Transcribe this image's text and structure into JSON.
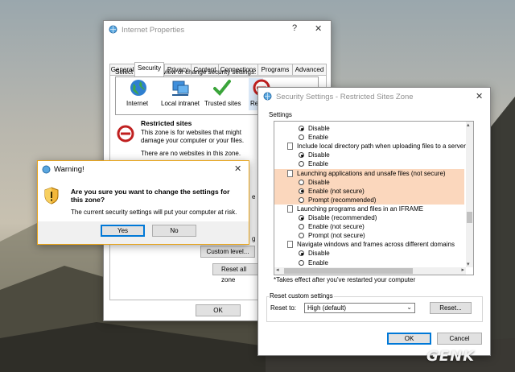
{
  "internet_properties": {
    "title": "Internet Properties",
    "help": "?",
    "close": "✕",
    "tabs": [
      "General",
      "Security",
      "Privacy",
      "Content",
      "Connections",
      "Programs",
      "Advanced"
    ],
    "select_zone_text": "Select a zone to view or change security settings.",
    "zones": [
      {
        "label": "Internet",
        "icon": "globe-icon"
      },
      {
        "label": "Local intranet",
        "icon": "intranet-icon"
      },
      {
        "label": "Trusted sites",
        "icon": "checkmark-icon"
      },
      {
        "label": "Re",
        "icon": "restricted-icon"
      }
    ],
    "zone_heading": "Restricted sites",
    "zone_desc_line1": "This zone is for websites that might",
    "zone_desc_line2": "damage your computer or your files.",
    "zone_desc_line3": "There are no websites in this zone.",
    "custom_level": "Custom level...",
    "reset_all": "Reset all zone",
    "ok": "OK",
    "behind_text_1": "e",
    "behind_text_2": "g"
  },
  "warning": {
    "title": "Warning!",
    "close": "✕",
    "question_line1": "Are you sure you want to change the settings for",
    "question_line2": "this zone?",
    "detail": "The current security settings will put your computer at risk.",
    "yes": "Yes",
    "no": "No"
  },
  "security_settings": {
    "title": "Security Settings - Restricted Sites Zone",
    "close": "✕",
    "settings_label": "Settings",
    "rows": [
      {
        "kind": "radio",
        "label": "Disable",
        "checked": true
      },
      {
        "kind": "radio",
        "label": "Enable",
        "checked": false
      },
      {
        "kind": "heading",
        "label": "Include local directory path when uploading files to a server"
      },
      {
        "kind": "radio",
        "label": "Disable",
        "checked": true
      },
      {
        "kind": "radio",
        "label": "Enable",
        "checked": false
      },
      {
        "kind": "heading",
        "label": "Launching applications and unsafe files (not secure)",
        "highlight": true
      },
      {
        "kind": "radio",
        "label": "Disable",
        "checked": false,
        "highlight": true
      },
      {
        "kind": "radio",
        "label": "Enable (not secure)",
        "checked": true,
        "highlight": true
      },
      {
        "kind": "radio",
        "label": "Prompt (recommended)",
        "checked": false,
        "highlight": true
      },
      {
        "kind": "heading",
        "label": "Launching programs and files in an IFRAME"
      },
      {
        "kind": "radio",
        "label": "Disable (recommended)",
        "checked": true
      },
      {
        "kind": "radio",
        "label": "Enable (not secure)",
        "checked": false
      },
      {
        "kind": "radio",
        "label": "Prompt (not secure)",
        "checked": false
      },
      {
        "kind": "heading",
        "label": "Navigate windows and frames across different domains"
      },
      {
        "kind": "radio",
        "label": "Disable",
        "checked": true
      },
      {
        "kind": "radio",
        "label": "Enable",
        "checked": false
      }
    ],
    "footnote": "*Takes effect after you've restarted your computer",
    "reset_group": "Reset custom settings",
    "reset_to_label": "Reset to:",
    "reset_to_value": "High (default)",
    "reset_button": "Reset...",
    "ok": "OK",
    "cancel": "Cancel"
  },
  "watermark": "GENK",
  "colors": {
    "highlight": "#fbd7bd",
    "accent": "#0078d7",
    "warning_bg": "#f0f0f0"
  }
}
